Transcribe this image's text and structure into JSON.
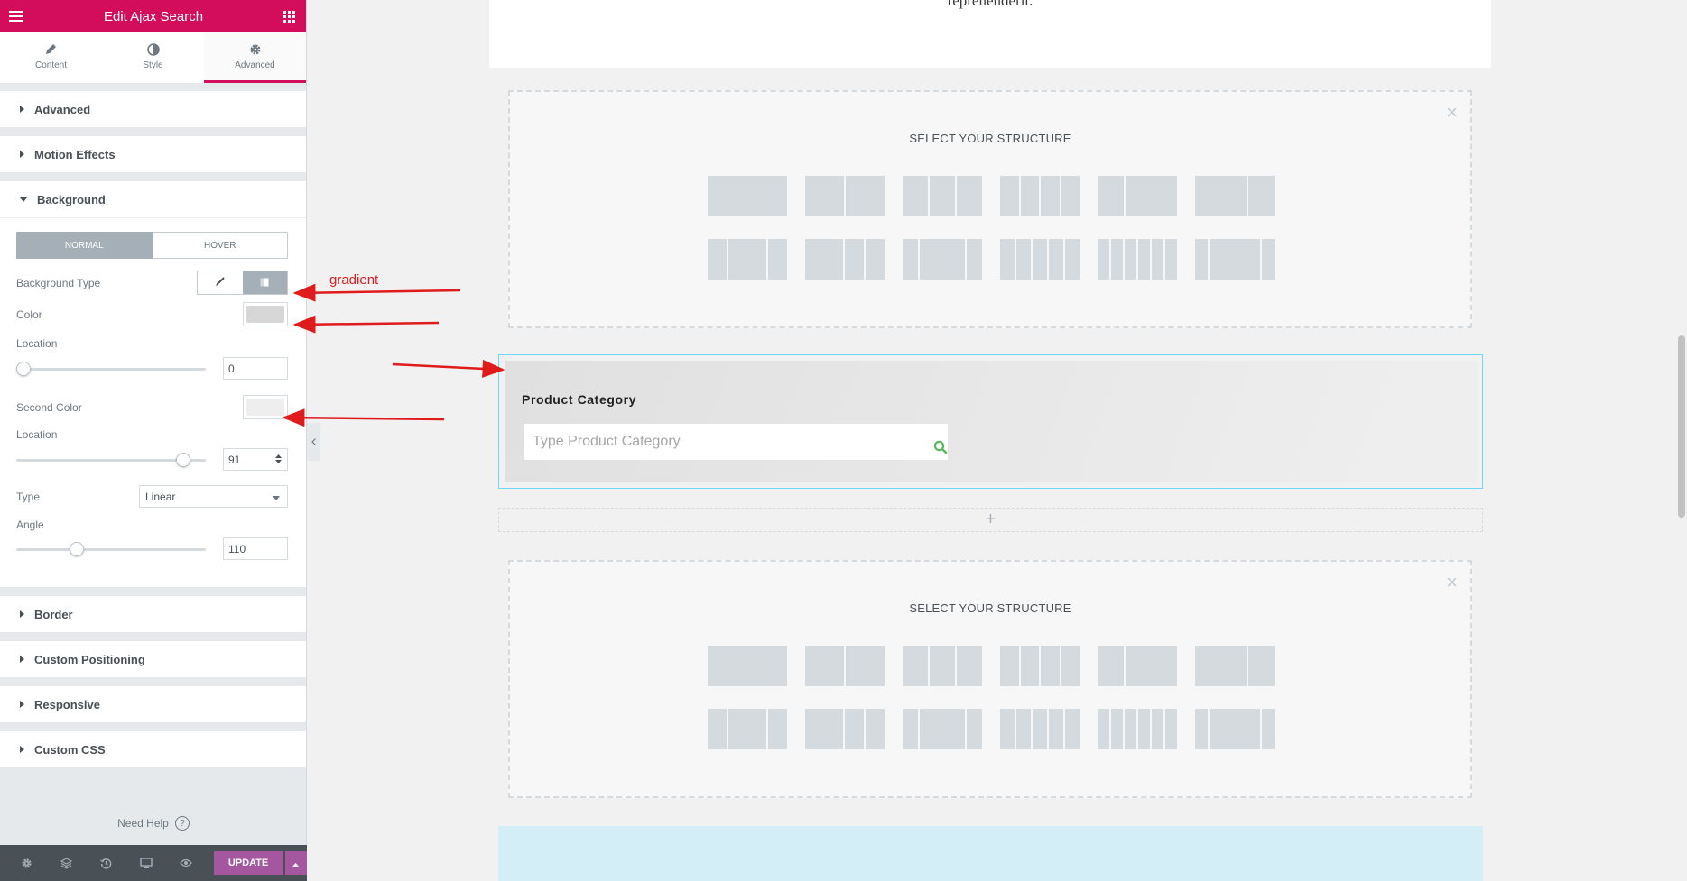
{
  "header": {
    "title": "Edit Ajax Search"
  },
  "tabs": [
    {
      "label": "Content"
    },
    {
      "label": "Style"
    },
    {
      "label": "Advanced"
    }
  ],
  "sections": {
    "advanced": "Advanced",
    "motion": "Motion Effects",
    "background": "Background",
    "border": "Border",
    "custom_positioning": "Custom Positioning",
    "responsive": "Responsive",
    "custom_css": "Custom CSS"
  },
  "background": {
    "normal_label": "NORMAL",
    "hover_label": "HOVER",
    "bg_type_label": "Background Type",
    "color_label": "Color",
    "color_value": "#d7d7d7",
    "location_label": "Location",
    "location_value": "0",
    "location_fraction": 0,
    "second_color_label": "Second Color",
    "second_color_value": "#eeeeee",
    "location2_label": "Location",
    "location2_value": "91",
    "location2_fraction": 0.91,
    "type_label": "Type",
    "type_value": "Linear",
    "angle_label": "Angle",
    "angle_value": "110",
    "angle_fraction": 0.306
  },
  "help": {
    "label": "Need Help"
  },
  "footer": {
    "update_label": "UPDATE"
  },
  "preview": {
    "top_text": "reprehenderit.",
    "structure_title": "SELECT YOUR STRUCTURE",
    "product_title": "Product Category",
    "search_placeholder": "Type Product Category"
  },
  "annotations": {
    "gradient_label": "gradient"
  },
  "colors": {
    "brand": "#d30c5c",
    "update": "#a4579f",
    "arrow": "#e01b1b"
  }
}
